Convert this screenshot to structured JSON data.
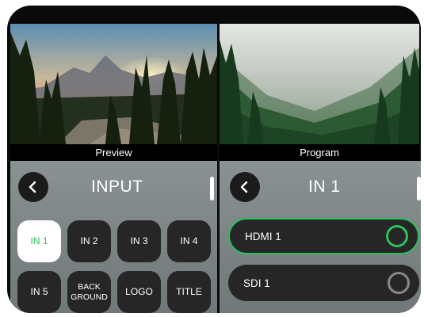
{
  "monitors": {
    "preview_label": "Preview",
    "program_label": "Program"
  },
  "input_panel": {
    "title": "INPUT",
    "back_icon": "chevron-left-icon",
    "buttons": [
      {
        "label": "IN 1",
        "active": true
      },
      {
        "label": "IN 2",
        "active": false
      },
      {
        "label": "IN 3",
        "active": false
      },
      {
        "label": "IN 4",
        "active": false
      },
      {
        "label": "IN 5",
        "active": false
      },
      {
        "label": "BACK\nGROUND",
        "active": false
      },
      {
        "label": "LOGO",
        "active": false
      },
      {
        "label": "TITLE",
        "active": false
      }
    ]
  },
  "source_panel": {
    "title": "IN 1",
    "back_icon": "chevron-left-icon",
    "sources": [
      {
        "label": "HDMI 1",
        "selected": true
      },
      {
        "label": "SDI 1",
        "selected": false
      }
    ]
  },
  "colors": {
    "accent_green": "#2fbf5b",
    "button_dark": "#262626",
    "panel_gray": "#7b8385"
  }
}
